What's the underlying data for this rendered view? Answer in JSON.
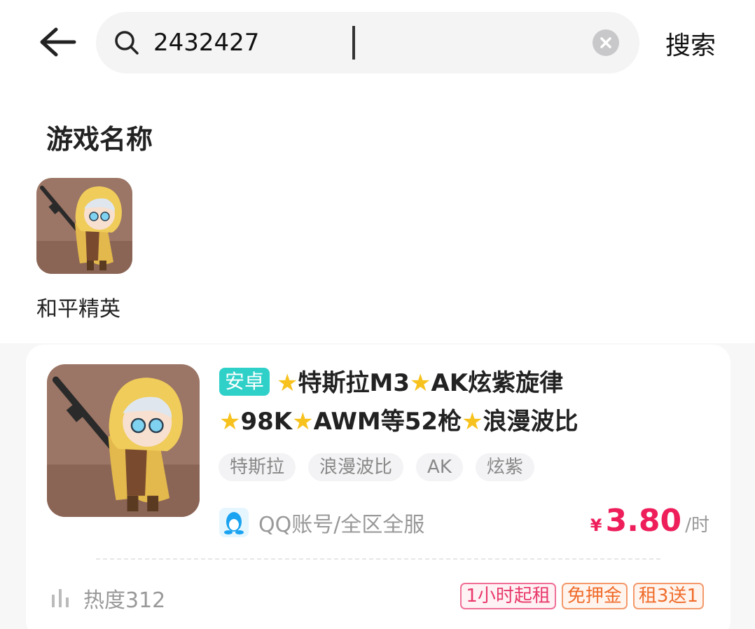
{
  "search": {
    "back_icon": "arrow-left-icon",
    "search_icon": "magnifier-icon",
    "query": "2432427",
    "clear_icon": "clear-circle-icon",
    "search_button_label": "搜索"
  },
  "games_section": {
    "title": "游戏名称",
    "games": [
      {
        "name": "和平精英",
        "icon": "game-character-thumbnail"
      }
    ]
  },
  "listings": [
    {
      "platform": "安卓",
      "title_segments": [
        "特斯拉M3",
        "AK炫紫旋律",
        "98K",
        "AWM等52枪",
        "浪漫波比"
      ],
      "tags": [
        "特斯拉",
        "浪漫波比",
        "AK",
        "炫紫"
      ],
      "account_type": "QQ账号/全区全服",
      "price": {
        "currency": "¥",
        "amount": "3.80",
        "unit": "/时"
      },
      "heat": "热度312",
      "badges": [
        "1小时起租",
        "免押金",
        "租3送1"
      ],
      "colors": {
        "platform_badge": "#2fd0c8",
        "price": "#ee1e5b",
        "star": "#f7c21e"
      }
    }
  ]
}
